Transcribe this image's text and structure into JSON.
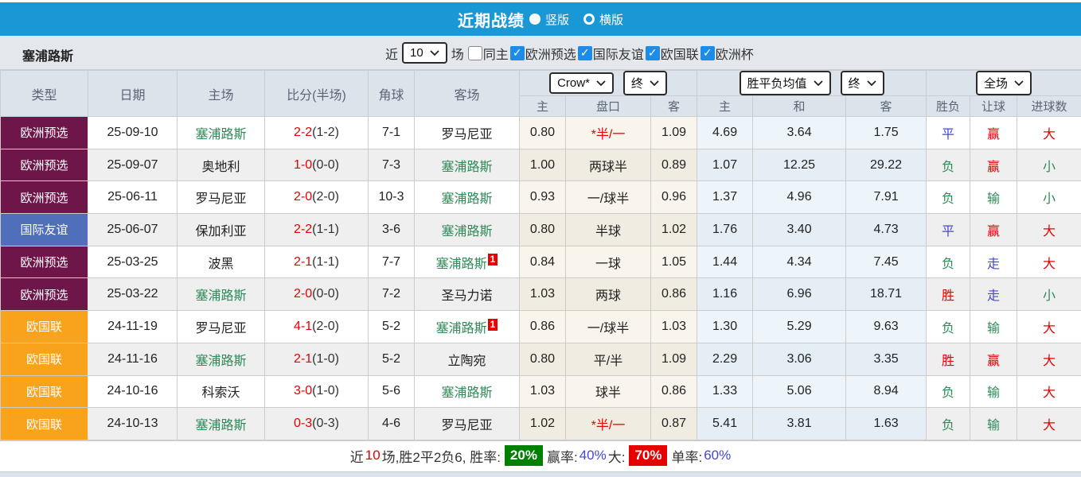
{
  "topbar": {
    "title": "近期战绩",
    "radios": [
      {
        "label": "竖版",
        "selected": true
      },
      {
        "label": "横版",
        "selected": false
      }
    ]
  },
  "filterbar": {
    "team": "塞浦路斯",
    "recent_label": "近",
    "recent_value": "10",
    "recent_suffix": "场",
    "filters": [
      {
        "label": "同主",
        "checked": false
      },
      {
        "label": "欧洲预选",
        "checked": true
      },
      {
        "label": "国际友谊",
        "checked": true
      },
      {
        "label": "欧国联",
        "checked": true
      },
      {
        "label": "欧洲杯",
        "checked": true
      }
    ]
  },
  "table": {
    "headers": {
      "type": "类型",
      "date": "日期",
      "home": "主场",
      "score": "比分(半场)",
      "corner": "角球",
      "away": "客场"
    },
    "selects": {
      "company": "Crow*",
      "company_time": "终",
      "avg": "胜平负均值",
      "avg_time": "终",
      "scope": "全场"
    },
    "subheaders": [
      "主",
      "盘口",
      "客",
      "主",
      "和",
      "客",
      "胜负",
      "让球",
      "进球数"
    ],
    "type_colors": {
      "uefa_qual": "#6e164a",
      "friendly": "#4f6fba",
      "nations": "#f9a21b"
    },
    "accent_colors": {
      "red": "#e60000",
      "green": "#2e8b57",
      "blue": "#4545d8"
    },
    "rows": [
      {
        "type": "欧洲预选",
        "type_class": "uefa_qual",
        "date": "25-09-10",
        "home": "塞浦路斯",
        "home_green": true,
        "score": "2-2",
        "half": "(1-2)",
        "corner": "7-1",
        "away": "罗马尼亚",
        "away_green": false,
        "away_badge": "",
        "odds": [
          "0.80",
          "*半/一",
          "1.09"
        ],
        "handicap_red": true,
        "avg": [
          "4.69",
          "3.64",
          "1.75"
        ],
        "results": [
          {
            "text": "平",
            "c": "blue"
          },
          {
            "text": "赢",
            "c": "red"
          },
          {
            "text": "大",
            "c": "red"
          }
        ]
      },
      {
        "type": "欧洲预选",
        "type_class": "uefa_qual",
        "date": "25-09-07",
        "home": "奥地利",
        "home_green": false,
        "score": "1-0",
        "half": "(0-0)",
        "corner": "7-3",
        "away": "塞浦路斯",
        "away_green": true,
        "away_badge": "",
        "odds": [
          "1.00",
          "两球半",
          "0.89"
        ],
        "handicap_red": false,
        "avg": [
          "1.07",
          "12.25",
          "29.22"
        ],
        "results": [
          {
            "text": "负",
            "c": "green"
          },
          {
            "text": "赢",
            "c": "red"
          },
          {
            "text": "小",
            "c": "green"
          }
        ]
      },
      {
        "type": "欧洲预选",
        "type_class": "uefa_qual",
        "date": "25-06-11",
        "home": "罗马尼亚",
        "home_green": false,
        "score": "2-0",
        "half": "(2-0)",
        "corner": "10-3",
        "away": "塞浦路斯",
        "away_green": true,
        "away_badge": "",
        "odds": [
          "0.93",
          "一/球半",
          "0.96"
        ],
        "handicap_red": false,
        "avg": [
          "1.37",
          "4.96",
          "7.91"
        ],
        "results": [
          {
            "text": "负",
            "c": "green"
          },
          {
            "text": "输",
            "c": "green"
          },
          {
            "text": "小",
            "c": "green"
          }
        ]
      },
      {
        "type": "国际友谊",
        "type_class": "friendly",
        "date": "25-06-07",
        "home": "保加利亚",
        "home_green": false,
        "score": "2-2",
        "half": "(1-1)",
        "corner": "3-6",
        "away": "塞浦路斯",
        "away_green": true,
        "away_badge": "",
        "odds": [
          "0.80",
          "半球",
          "1.02"
        ],
        "handicap_red": false,
        "avg": [
          "1.76",
          "3.40",
          "4.73"
        ],
        "results": [
          {
            "text": "平",
            "c": "blue"
          },
          {
            "text": "赢",
            "c": "red"
          },
          {
            "text": "大",
            "c": "red"
          }
        ]
      },
      {
        "type": "欧洲预选",
        "type_class": "uefa_qual",
        "date": "25-03-25",
        "home": "波黑",
        "home_green": false,
        "score": "2-1",
        "half": "(1-1)",
        "corner": "7-7",
        "away": "塞浦路斯",
        "away_green": true,
        "away_badge": "1",
        "odds": [
          "0.84",
          "一球",
          "1.05"
        ],
        "handicap_red": false,
        "avg": [
          "1.44",
          "4.34",
          "7.45"
        ],
        "results": [
          {
            "text": "负",
            "c": "green"
          },
          {
            "text": "走",
            "c": "blue"
          },
          {
            "text": "大",
            "c": "red"
          }
        ]
      },
      {
        "type": "欧洲预选",
        "type_class": "uefa_qual",
        "date": "25-03-22",
        "home": "塞浦路斯",
        "home_green": true,
        "score": "2-0",
        "half": "(0-0)",
        "corner": "7-2",
        "away": "圣马力诺",
        "away_green": false,
        "away_badge": "",
        "odds": [
          "1.03",
          "两球",
          "0.86"
        ],
        "handicap_red": false,
        "avg": [
          "1.16",
          "6.96",
          "18.71"
        ],
        "results": [
          {
            "text": "胜",
            "c": "red"
          },
          {
            "text": "走",
            "c": "blue"
          },
          {
            "text": "小",
            "c": "green"
          }
        ]
      },
      {
        "type": "欧国联",
        "type_class": "nations",
        "date": "24-11-19",
        "home": "罗马尼亚",
        "home_green": false,
        "score": "4-1",
        "half": "(2-0)",
        "corner": "5-2",
        "away": "塞浦路斯",
        "away_green": true,
        "away_badge": "1",
        "odds": [
          "0.86",
          "一/球半",
          "1.03"
        ],
        "handicap_red": false,
        "avg": [
          "1.30",
          "5.29",
          "9.63"
        ],
        "results": [
          {
            "text": "负",
            "c": "green"
          },
          {
            "text": "输",
            "c": "green"
          },
          {
            "text": "大",
            "c": "red"
          }
        ]
      },
      {
        "type": "欧国联",
        "type_class": "nations",
        "date": "24-11-16",
        "home": "塞浦路斯",
        "home_green": true,
        "score": "2-1",
        "half": "(1-0)",
        "corner": "5-2",
        "away": "立陶宛",
        "away_green": false,
        "away_badge": "",
        "odds": [
          "0.80",
          "平/半",
          "1.09"
        ],
        "handicap_red": false,
        "avg": [
          "2.29",
          "3.06",
          "3.35"
        ],
        "results": [
          {
            "text": "胜",
            "c": "red"
          },
          {
            "text": "赢",
            "c": "red"
          },
          {
            "text": "大",
            "c": "red"
          }
        ]
      },
      {
        "type": "欧国联",
        "type_class": "nations",
        "date": "24-10-16",
        "home": "科索沃",
        "home_green": false,
        "score": "3-0",
        "half": "(1-0)",
        "corner": "5-6",
        "away": "塞浦路斯",
        "away_green": true,
        "away_badge": "",
        "odds": [
          "1.03",
          "球半",
          "0.86"
        ],
        "handicap_red": false,
        "avg": [
          "1.33",
          "5.06",
          "8.94"
        ],
        "results": [
          {
            "text": "负",
            "c": "green"
          },
          {
            "text": "输",
            "c": "green"
          },
          {
            "text": "大",
            "c": "red"
          }
        ]
      },
      {
        "type": "欧国联",
        "type_class": "nations",
        "date": "24-10-13",
        "home": "塞浦路斯",
        "home_green": true,
        "score": "0-3",
        "half": "(0-3)",
        "corner": "4-6",
        "away": "罗马尼亚",
        "away_green": false,
        "away_badge": "",
        "odds": [
          "1.02",
          "*半/一",
          "0.87"
        ],
        "handicap_red": true,
        "avg": [
          "5.41",
          "3.81",
          "1.63"
        ],
        "results": [
          {
            "text": "负",
            "c": "green"
          },
          {
            "text": "输",
            "c": "green"
          },
          {
            "text": "大",
            "c": "red"
          }
        ]
      }
    ]
  },
  "footer": {
    "parts": [
      {
        "text": "近"
      },
      {
        "text": "10",
        "style": "red"
      },
      {
        "text": "场,胜2平2负6, 胜率: "
      },
      {
        "text": "20%",
        "style": "chip-green"
      },
      {
        "text": " 赢率:"
      },
      {
        "text": "40%",
        "style": "blue"
      },
      {
        "text": " 大: "
      },
      {
        "text": "70%",
        "style": "chip-red"
      },
      {
        "text": " 单率:"
      },
      {
        "text": "60%",
        "style": "blue"
      }
    ]
  }
}
